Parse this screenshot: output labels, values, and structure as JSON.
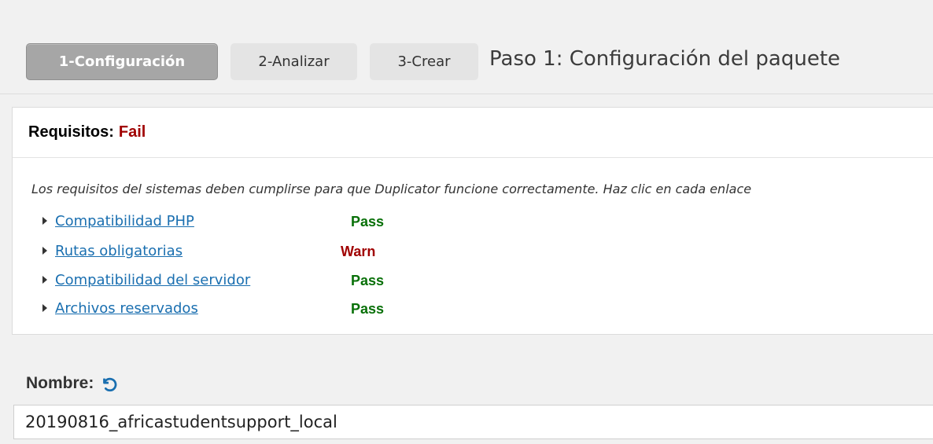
{
  "steps": {
    "step1_label": "1-Configuración",
    "step2_label": "2-Analizar",
    "step3_label": "3-Crear",
    "current_title": "Paso 1: Configuración del paquete"
  },
  "requirements": {
    "heading": "Requisitos:",
    "overall_status": "Fail",
    "description": "Los requisitos del sistemas deben cumplirse para que Duplicator funcione correctamente. Haz clic en cada enlace",
    "items": [
      {
        "label": "Compatibilidad PHP",
        "status": "Pass"
      },
      {
        "label": "Rutas obligatorias",
        "status": "Warn"
      },
      {
        "label": "Compatibilidad del servidor",
        "status": "Pass"
      },
      {
        "label": "Archivos reservados",
        "status": "Pass"
      }
    ]
  },
  "name_field": {
    "label": "Nombre:",
    "value": "20190816_africastudentsupport_local",
    "reset_icon": "undo-icon"
  },
  "colors": {
    "pass": "#087008",
    "fail": "#a00000",
    "link": "#1a6fb0",
    "active_step": "#a6a6a6"
  }
}
